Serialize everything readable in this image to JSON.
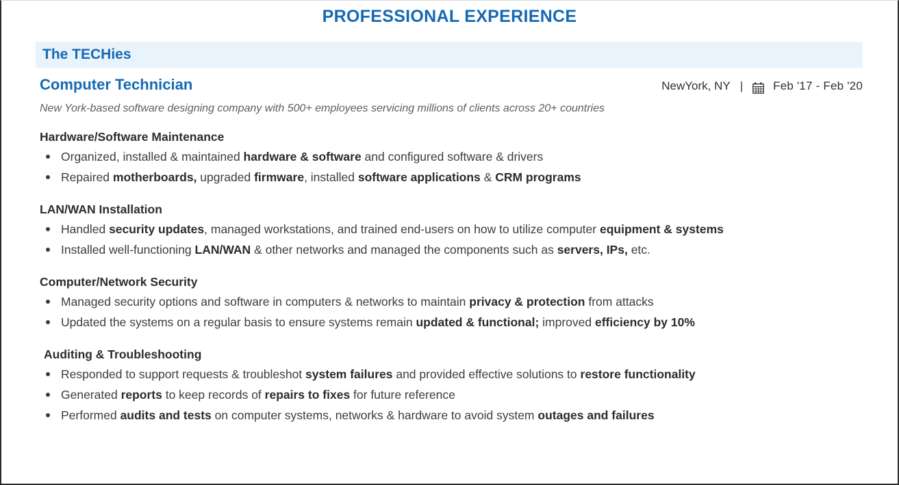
{
  "section": {
    "title": "PROFESSIONAL EXPERIENCE",
    "accent_color": "#1569b4",
    "banner_color": "#e9f3fc"
  },
  "experience": {
    "company": "The TECHies",
    "role": "Computer Technician",
    "location": "NewYork, NY",
    "separator": "|",
    "calendar_icon": "calendar-icon",
    "dates": "Feb '17  -  Feb '20",
    "description": "New York-based software designing company with 500+ employees servicing millions of clients across 20+ countries",
    "subsections": [
      {
        "heading": "Hardware/Software Maintenance",
        "bullets": [
          [
            {
              "t": "Organized, installed & maintained ",
              "b": false
            },
            {
              "t": "hardware & software",
              "b": true
            },
            {
              "t": " and configured software & drivers",
              "b": false
            }
          ],
          [
            {
              "t": "Repaired ",
              "b": false
            },
            {
              "t": "motherboards,",
              "b": true
            },
            {
              "t": " upgraded ",
              "b": false
            },
            {
              "t": "firmware",
              "b": true
            },
            {
              "t": ", installed ",
              "b": false
            },
            {
              "t": "software applications",
              "b": true
            },
            {
              "t": " & ",
              "b": false
            },
            {
              "t": "CRM programs",
              "b": true
            }
          ]
        ]
      },
      {
        "heading": "LAN/WAN Installation",
        "bullets": [
          [
            {
              "t": "Handled ",
              "b": false
            },
            {
              "t": "security updates",
              "b": true
            },
            {
              "t": ", managed workstations, and trained end-users on how to utilize computer ",
              "b": false
            },
            {
              "t": "equipment & systems",
              "b": true
            }
          ],
          [
            {
              "t": "Installed well-functioning ",
              "b": false
            },
            {
              "t": "LAN/WAN",
              "b": true
            },
            {
              "t": " & other networks and managed the components such as ",
              "b": false
            },
            {
              "t": "servers, IPs,",
              "b": true
            },
            {
              "t": " etc.",
              "b": false
            }
          ]
        ]
      },
      {
        "heading": "Computer/Network Security",
        "bullets": [
          [
            {
              "t": "Managed security options and software in computers & networks to maintain ",
              "b": false
            },
            {
              "t": "privacy & protection",
              "b": true
            },
            {
              "t": " from attacks",
              "b": false
            }
          ],
          [
            {
              "t": "Updated the systems on a regular basis to ensure systems remain ",
              "b": false
            },
            {
              "t": "updated & functional;",
              "b": true
            },
            {
              "t": " improved ",
              "b": false
            },
            {
              "t": "efficiency by 10%",
              "b": true
            }
          ]
        ]
      },
      {
        "heading": "Auditing & Troubleshooting",
        "indented": true,
        "bullets": [
          [
            {
              "t": "Responded to support requests & troubleshot ",
              "b": false
            },
            {
              "t": "system failures",
              "b": true
            },
            {
              "t": " and provided effective solutions to ",
              "b": false
            },
            {
              "t": "restore functionality",
              "b": true
            }
          ],
          [
            {
              "t": "Generated ",
              "b": false
            },
            {
              "t": "reports",
              "b": true
            },
            {
              "t": " to keep records of ",
              "b": false
            },
            {
              "t": "repairs to fixes",
              "b": true
            },
            {
              "t": " for future reference",
              "b": false
            }
          ],
          [
            {
              "t": "Performed ",
              "b": false
            },
            {
              "t": "audits and tests",
              "b": true
            },
            {
              "t": " on computer systems, networks & hardware to avoid system ",
              "b": false
            },
            {
              "t": "outages and failures",
              "b": true
            }
          ]
        ]
      }
    ]
  }
}
